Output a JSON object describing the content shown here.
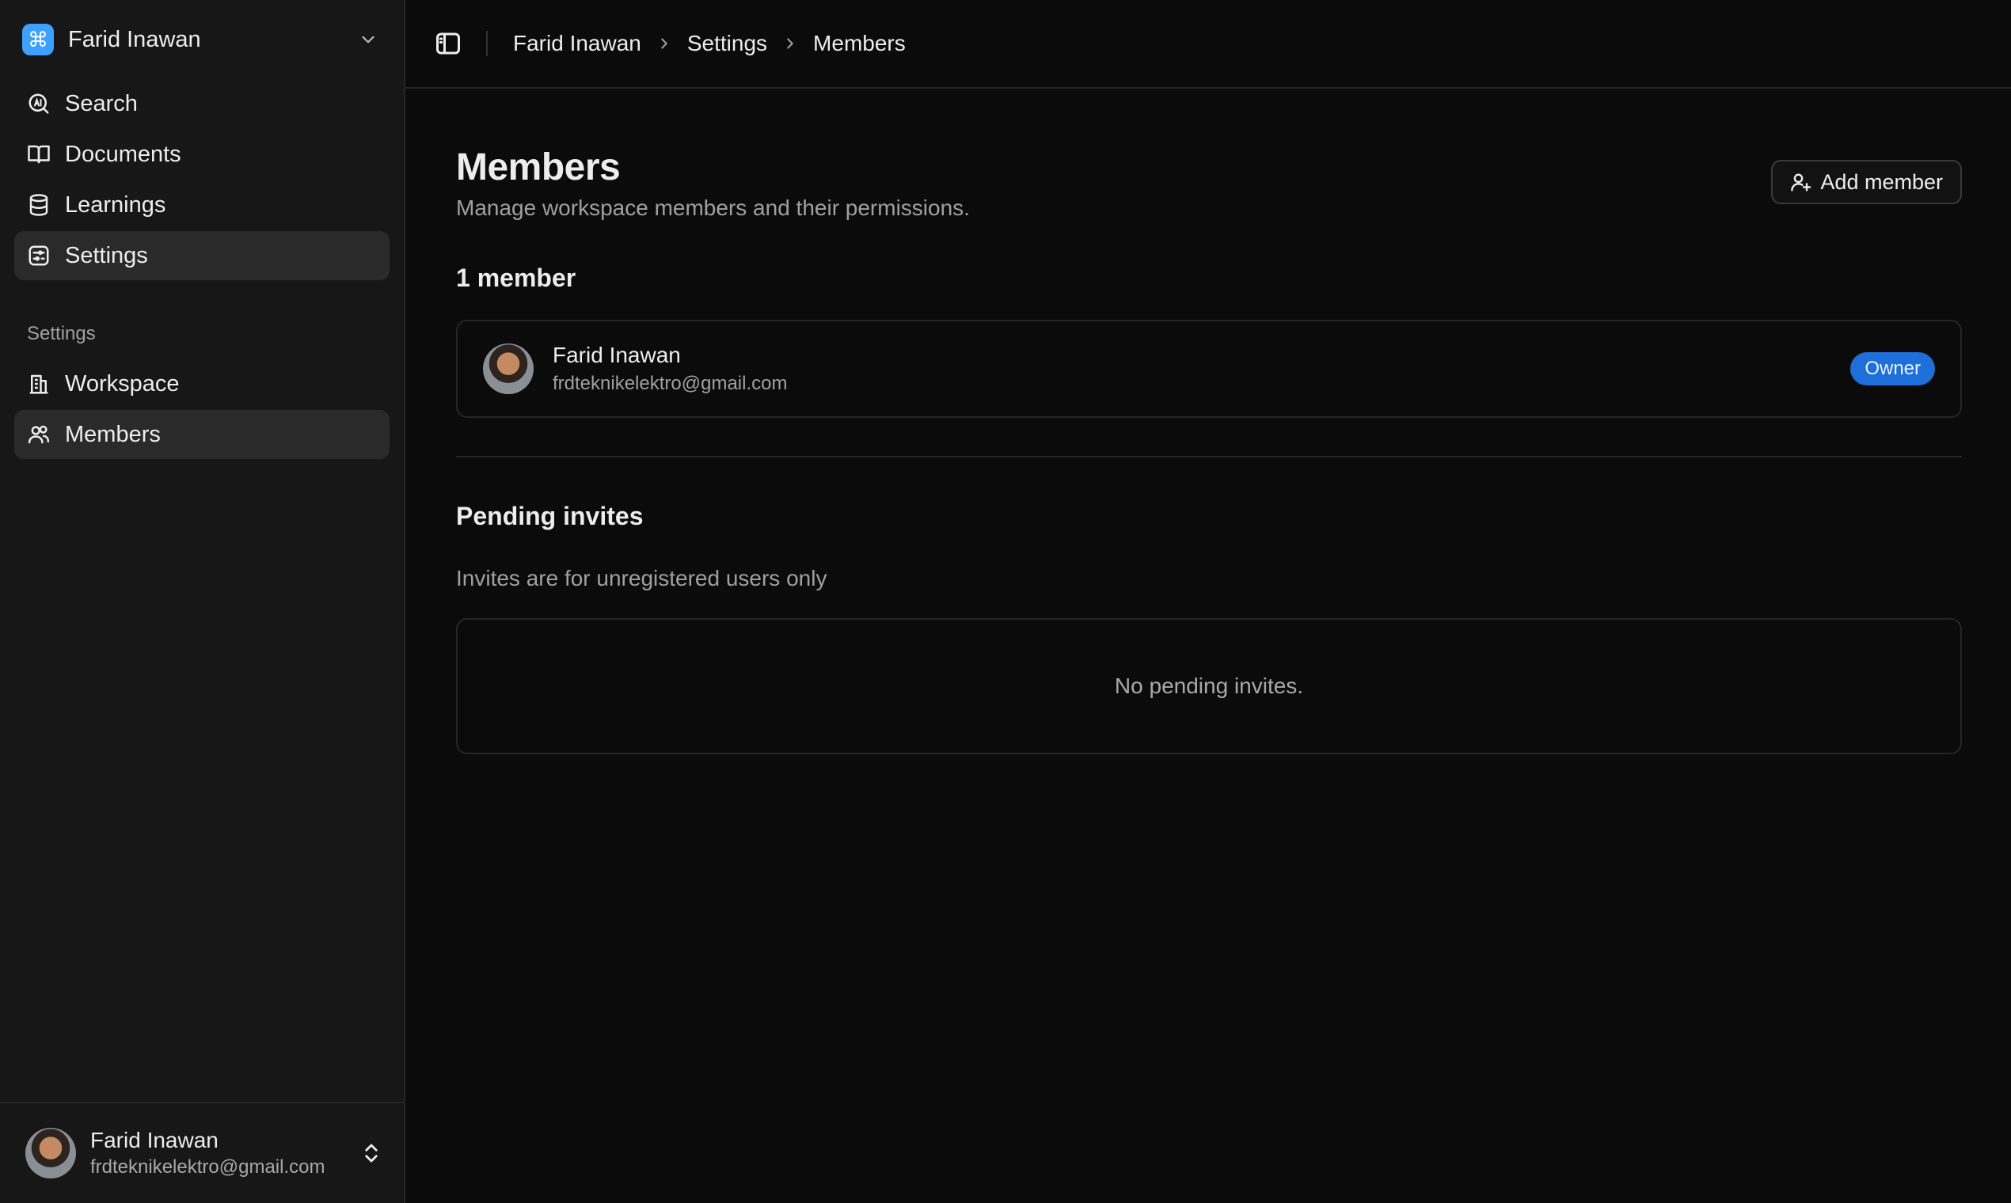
{
  "workspace": {
    "name": "Farid Inawan",
    "logo_icon": "command-icon",
    "accent": "#3ea0ff"
  },
  "nav": {
    "items": [
      {
        "label": "Search",
        "icon": "ai-search-icon"
      },
      {
        "label": "Documents",
        "icon": "book-icon"
      },
      {
        "label": "Learnings",
        "icon": "database-icon"
      },
      {
        "label": "Settings",
        "icon": "settings-icon",
        "active": true
      }
    ],
    "section_label": "Settings",
    "settings_items": [
      {
        "label": "Workspace",
        "icon": "building-icon"
      },
      {
        "label": "Members",
        "icon": "users-icon",
        "active": true
      }
    ]
  },
  "user": {
    "name": "Farid Inawan",
    "email": "frdteknikelektro@gmail.com"
  },
  "breadcrumb": [
    "Farid Inawan",
    "Settings",
    "Members"
  ],
  "page": {
    "title": "Members",
    "subtitle": "Manage workspace members and their permissions.",
    "add_button_label": "Add member"
  },
  "members": {
    "count_label": "1 member",
    "list": [
      {
        "name": "Farid Inawan",
        "email": "frdteknikelektro@gmail.com",
        "role": "Owner",
        "role_color": "#1e6fd9"
      }
    ]
  },
  "pending": {
    "title": "Pending invites",
    "description": "Invites are for unregistered users only",
    "empty_text": "No pending invites."
  }
}
